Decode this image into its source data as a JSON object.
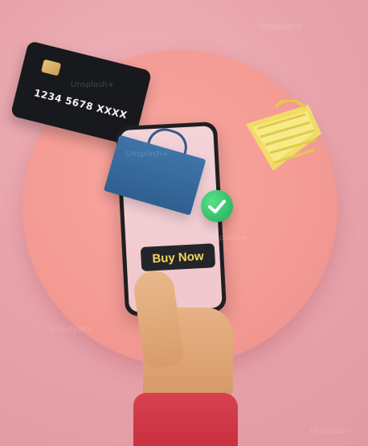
{
  "image": {
    "card_number": "1234 5678 XXXX",
    "button_label": "Buy Now",
    "watermark_text": "Unsplash+"
  },
  "colors": {
    "background": "#e9a6ad",
    "disc": "#f39a93",
    "card": "#17191c",
    "bag": "#3f74a8",
    "check": "#22a957",
    "basket": "#f0de64",
    "sleeve": "#d84150",
    "button": "#24252a",
    "button_text": "#f3d75a"
  },
  "icons": {
    "check": "check-icon"
  }
}
